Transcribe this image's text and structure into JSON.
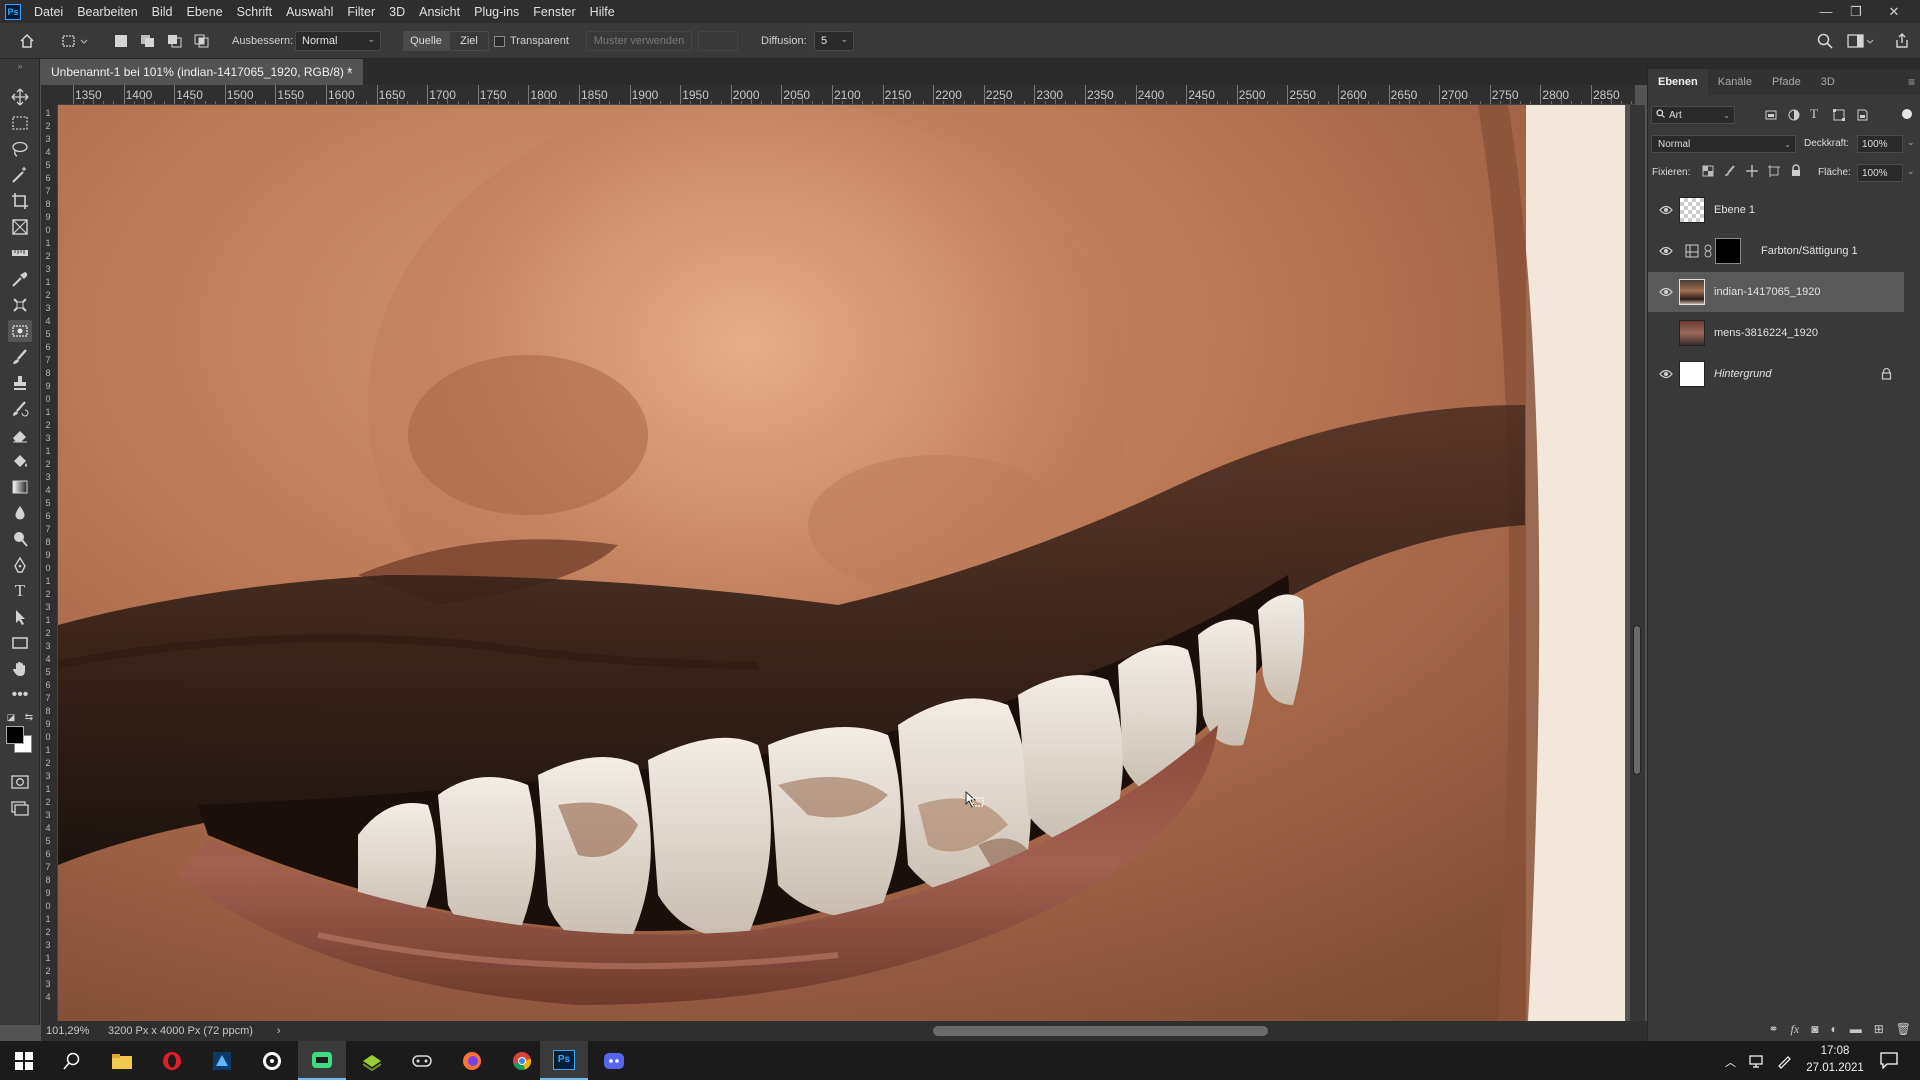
{
  "menubar": {
    "logo": "Ps",
    "items": [
      "Datei",
      "Bearbeiten",
      "Bild",
      "Ebene",
      "Schrift",
      "Auswahl",
      "Filter",
      "3D",
      "Ansicht",
      "Plug-ins",
      "Fenster",
      "Hilfe"
    ],
    "window_controls": [
      "—",
      "❐",
      "✕"
    ]
  },
  "options": {
    "ausbessern_label": "Ausbessern:",
    "ausbessern_value": "Normal",
    "quelle": "Quelle",
    "ziel": "Ziel",
    "transparent_label": "Transparent",
    "transparent_checked": false,
    "muster_verwenden": "Muster verwenden",
    "diffusion_label": "Diffusion:",
    "diffusion_value": "5"
  },
  "document": {
    "tab_title": "Unbenannt-1 bei 101% (indian-1417065_1920, RGB/8) *",
    "close": "×"
  },
  "ruler": {
    "h_labels": [
      "1350",
      "1400",
      "1450",
      "1500",
      "1550",
      "1600",
      "1650",
      "1700",
      "1750",
      "1800",
      "1850",
      "1900",
      "1950",
      "2000",
      "2050",
      "2100",
      "2150",
      "2200",
      "2250",
      "2300",
      "2350",
      "2400",
      "2450",
      "2500",
      "2550",
      "2600",
      "2650",
      "2700",
      "2750",
      "2800",
      "2850"
    ],
    "v_labels": [
      "1",
      "2",
      "3",
      "4",
      "5",
      "6",
      "7",
      "8",
      "9",
      "0",
      "1",
      "2",
      "3"
    ]
  },
  "status": {
    "zoom": "101,29%",
    "doc_size": "3200 Px x 4000 Px (72 ppcm)",
    "arrow": "›"
  },
  "panel": {
    "tabs": [
      "Ebenen",
      "Kanäle",
      "Pfade",
      "3D"
    ],
    "filter_label": "Art",
    "blend_mode": "Normal",
    "opacity_label": "Deckkraft:",
    "opacity_value": "100%",
    "lock_label": "Fixieren:",
    "fill_label": "Fläche:",
    "fill_value": "100%",
    "layers": [
      {
        "name": "Ebene 1",
        "visible": true
      },
      {
        "name": "Farbton/Sättigung 1",
        "visible": true
      },
      {
        "name": "indian-1417065_1920",
        "visible": true,
        "selected": true
      },
      {
        "name": "mens-3816224_1920",
        "visible": false
      },
      {
        "name": "Hintergrund",
        "visible": true,
        "locked": true
      }
    ]
  },
  "taskbar": {
    "time": "17:08",
    "date": "27.01.2021",
    "ps_label": "Ps"
  },
  "colors": {
    "accent": "#31a8ff",
    "panel_bg": "#393939",
    "menubar_bg": "#2e2e2e",
    "taskbar_bg": "#1b1b1b"
  }
}
